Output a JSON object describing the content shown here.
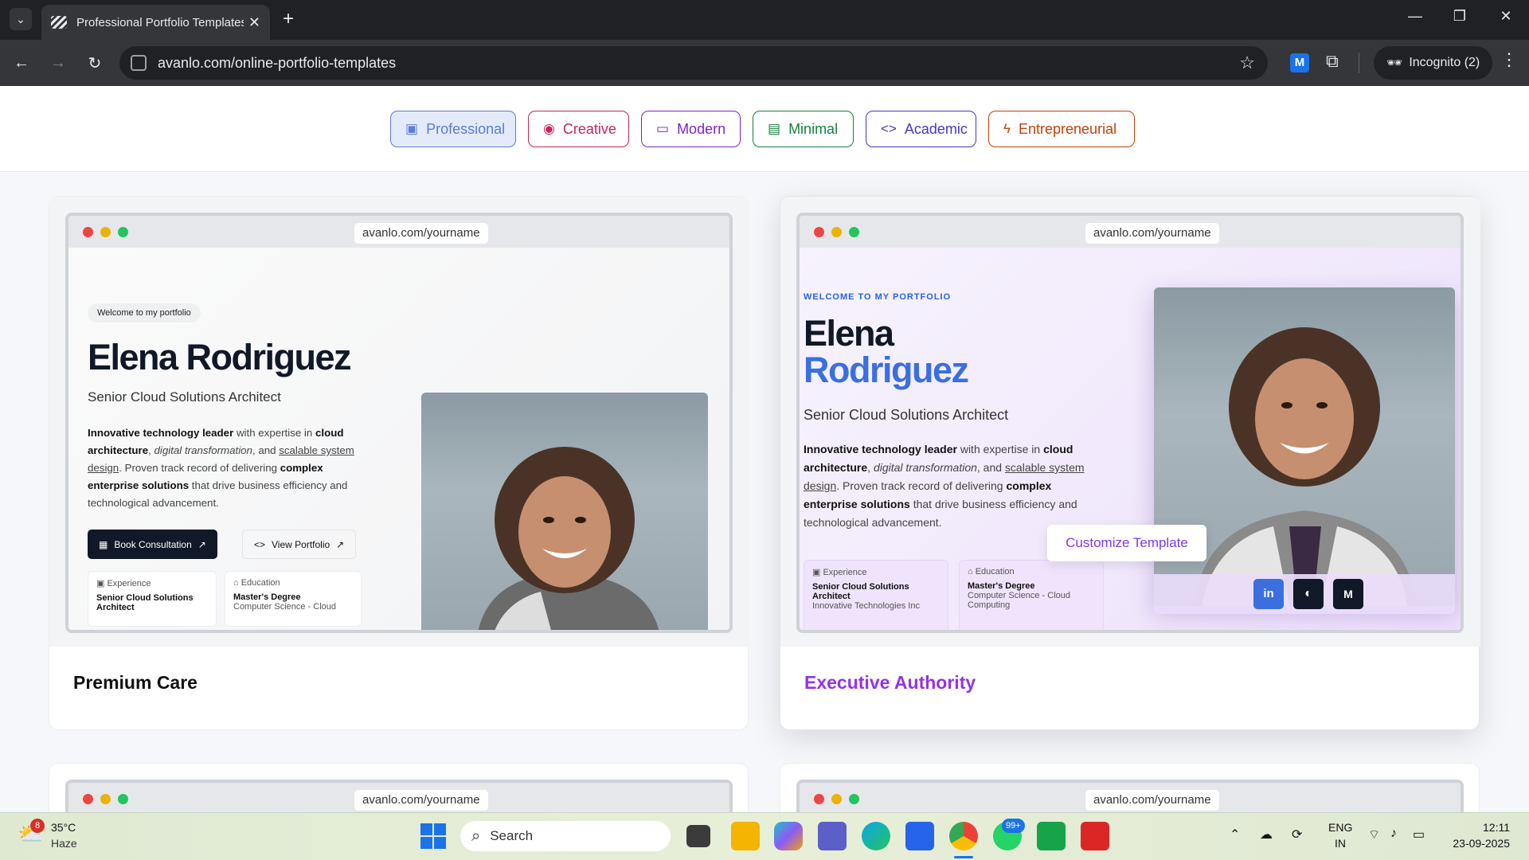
{
  "browser": {
    "tab_title": "Professional Portfolio Templates",
    "url": "avanlo.com/online-portfolio-templates",
    "profile": "Incognito (2)"
  },
  "categories": [
    {
      "label": "Professional",
      "icon": "briefcase-icon",
      "color": "#5b7bd6",
      "active": true
    },
    {
      "label": "Creative",
      "icon": "palette-icon",
      "color": "#c02661"
    },
    {
      "label": "Modern",
      "icon": "monitor-icon",
      "color": "#7e22ce"
    },
    {
      "label": "Minimal",
      "icon": "document-icon",
      "color": "#15803d"
    },
    {
      "label": "Academic",
      "icon": "code-icon",
      "color": "#4338ca"
    },
    {
      "label": "Entrepreneurial",
      "icon": "bolt-icon",
      "color": "#c2410c"
    }
  ],
  "cards": [
    {
      "title": "Premium Care",
      "preview_url": "avanlo.com/yourname",
      "welcome": "Welcome to my portfolio",
      "name": "Elena Rodriguez",
      "role": "Senior Cloud Solutions Architect",
      "primary_button": "Book Consultation",
      "secondary_button": "View Portfolio",
      "experience_label": "Experience",
      "experience_value": "Senior Cloud Solutions Architect",
      "education_label": "Education",
      "education_value": "Master's Degree",
      "education_detail": "Computer Science - Cloud"
    },
    {
      "title": "Executive Authority",
      "title_color": "#9333ea",
      "preview_url": "avanlo.com/yourname",
      "welcome": "WELCOME TO MY PORTFOLIO",
      "first_name": "Elena",
      "last_name": "Rodriguez",
      "role": "Senior Cloud Solutions Architect",
      "experience_label": "Experience",
      "experience_value": "Senior Cloud Solutions Architect",
      "experience_detail": "Innovative Technologies Inc",
      "education_label": "Education",
      "education_value": "Master's Degree",
      "education_detail": "Computer Science - Cloud Computing",
      "customize_button": "Customize Template"
    }
  ],
  "bio": {
    "p1": "Innovative technology leader",
    "p2": " with expertise in ",
    "p3": "cloud architecture",
    "p4": ", ",
    "p5": "digital transformation",
    "p6": ", and ",
    "p7": "scalable system design",
    "p8": ". Proven track record of delivering ",
    "p9": "complex enterprise solutions",
    "p10": " that drive business efficiency and technological advancement."
  },
  "lower_cards_url": "avanlo.com/yourname",
  "taskbar": {
    "weather_temp": "35°C",
    "weather_desc": "Haze",
    "weather_badge": "8",
    "search_label": "Search",
    "whatsapp_badge": "99+",
    "lang": "ENG",
    "region": "IN",
    "time": "12:11",
    "date": "23-09-2025"
  }
}
